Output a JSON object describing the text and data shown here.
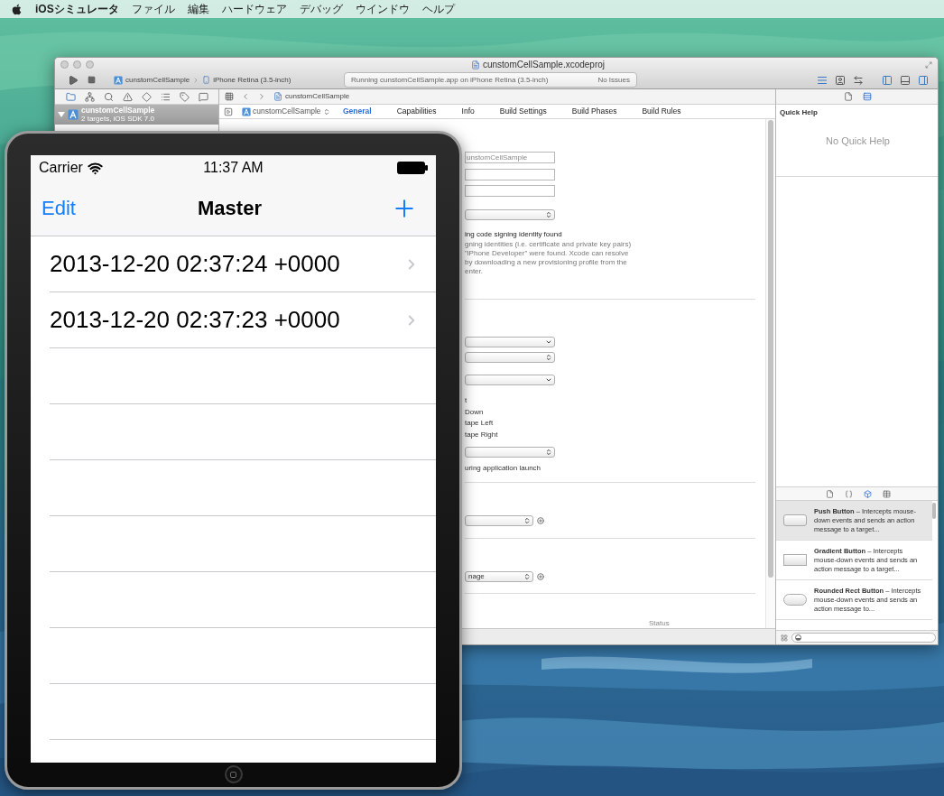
{
  "menu_bar": {
    "app_name": "iOSシミュレータ",
    "items": [
      "ファイル",
      "編集",
      "ハードウェア",
      "デバッグ",
      "ウインドウ",
      "ヘルプ"
    ]
  },
  "xcode": {
    "title": "cunstomCellSample.xcodeproj",
    "toolbar": {
      "scheme": "cunstomCellSample",
      "destination": "iPhone Retina (3.5-inch)",
      "activity": "Running cunstomCellSample.app on iPhone Retina (3.5-inch)",
      "issues": "No Issues"
    },
    "navigator": {
      "project": {
        "name": "cunstomCellSample",
        "subtitle": "2 targets, iOS SDK 7.0",
        "selected": true
      }
    },
    "jump_bar": {
      "path": "cunstomCellSample"
    },
    "target": "cunstomCellSample",
    "tabs": [
      {
        "label": "General",
        "selected": true
      },
      {
        "label": "Capabilities",
        "selected": false
      },
      {
        "label": "Info",
        "selected": false
      },
      {
        "label": "Build Settings",
        "selected": false
      },
      {
        "label": "Build Phases",
        "selected": false
      },
      {
        "label": "Build Rules",
        "selected": false
      }
    ],
    "editor_items": [
      {
        "kind": "field",
        "value": "unstomCellSample"
      },
      {
        "kind": "field"
      },
      {
        "kind": "field"
      },
      {
        "kind": "popup"
      },
      {
        "kind": "warning",
        "text": "ing code signing identity found"
      },
      {
        "kind": "note",
        "text": "gning identities (i.e. certificate and private key pairs)"
      },
      {
        "kind": "note",
        "text": "\"iPhone Developer\" were found.  Xcode can resolve"
      },
      {
        "kind": "note",
        "text": "by downloading a new provisioning profile from the"
      },
      {
        "kind": "note",
        "text": "enter."
      },
      {
        "kind": "divider"
      },
      {
        "kind": "combo"
      },
      {
        "kind": "popup"
      },
      {
        "kind": "combo"
      },
      {
        "kind": "option",
        "text": "t"
      },
      {
        "kind": "option",
        "text": "Down"
      },
      {
        "kind": "option",
        "text": "tape Left"
      },
      {
        "kind": "option",
        "text": "tape Right"
      },
      {
        "kind": "popup"
      },
      {
        "kind": "option",
        "text": "uring application launch"
      },
      {
        "kind": "divider"
      },
      {
        "kind": "popup_add"
      },
      {
        "kind": "divider"
      },
      {
        "kind": "popup_add",
        "value": "nage"
      },
      {
        "kind": "divider"
      },
      {
        "kind": "column_header",
        "text": "Status"
      }
    ],
    "quick_help": {
      "title": "Quick Help",
      "message": "No Quick Help"
    },
    "inspector_tabs": [
      {
        "selected": false
      },
      {
        "selected": true
      }
    ],
    "library_tabs": [
      {
        "selected": false
      },
      {
        "selected": false
      },
      {
        "selected": true
      },
      {
        "selected": false
      }
    ],
    "library": [
      {
        "text": "**Push Button** – Intercepts mouse-down events and sends an action message to a target...",
        "selected": true
      },
      {
        "text": "**Gradient Button** – Intercepts mouse-down events and sends an action message to a target...",
        "selected": false
      },
      {
        "text": "**Rounded Rect Button** – Intercepts mouse-down events and sends an action message to...",
        "selected": false
      }
    ]
  },
  "simulator": {
    "carrier": "Carrier",
    "time": "11:37 AM",
    "nav": {
      "left": "Edit",
      "title": "Master"
    },
    "rows": [
      "2013-12-20 02:37:24 +0000",
      "2013-12-20 02:37:23 +0000"
    ]
  }
}
